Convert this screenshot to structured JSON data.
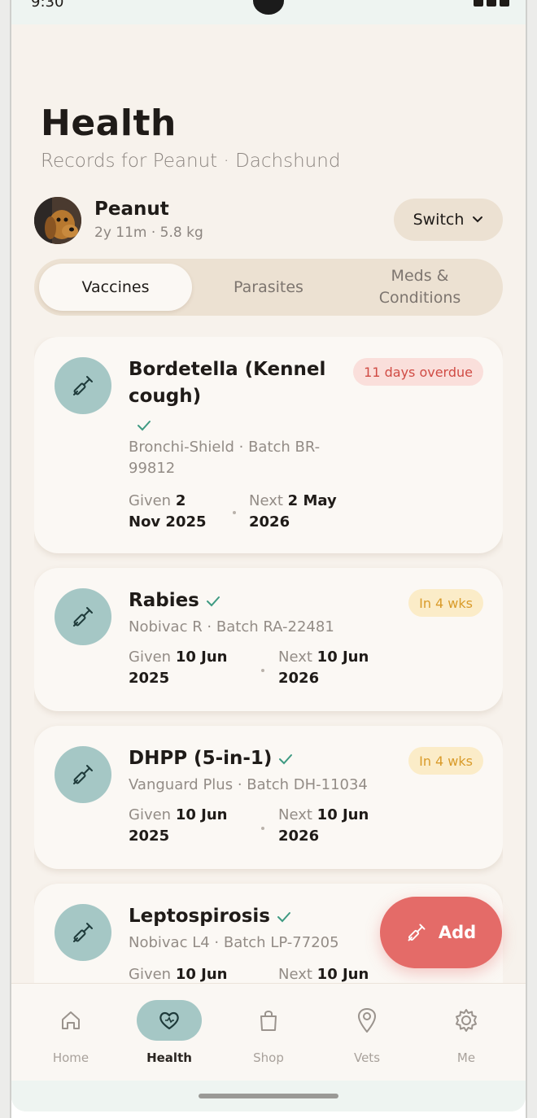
{
  "status": {
    "time": "9:30"
  },
  "header": {
    "title": "Health",
    "subtitle": "Records for Peanut · Dachshund"
  },
  "pet": {
    "name": "Peanut",
    "meta": "2y 11m · 5.8 kg",
    "switch_label": "Switch"
  },
  "tabs": [
    {
      "label": "Vaccines",
      "active": true
    },
    {
      "label": "Parasites",
      "active": false
    },
    {
      "label": "Meds & Conditions",
      "active": false
    }
  ],
  "vaccines": [
    {
      "name": "Bordetella (Kennel cough)",
      "brand_batch": "Bronchi-Shield · Batch BR-99812",
      "badge": "11 days overdue",
      "badge_status": "overdue",
      "given_label": "Given",
      "given_value": "2 Nov 2025",
      "next_label": "Next",
      "next_value": "2 May 2026"
    },
    {
      "name": "Rabies",
      "brand_batch": "Nobivac R · Batch RA-22481",
      "badge": "In 4 wks",
      "badge_status": "soon",
      "given_label": "Given",
      "given_value": "10 Jun 2025",
      "next_label": "Next",
      "next_value": "10 Jun 2026"
    },
    {
      "name": "DHPP (5-in-1)",
      "brand_batch": "Vanguard Plus · Batch DH-11034",
      "badge": "In 4 wks",
      "badge_status": "soon",
      "given_label": "Given",
      "given_value": "10 Jun 2025",
      "next_label": "Next",
      "next_value": "10 Jun 2026"
    },
    {
      "name": "Leptospirosis",
      "brand_batch": "Nobivac L4 · Batch LP-77205",
      "given_label": "Given",
      "given_value": "10 Jun",
      "next_label": "Next",
      "next_value": "10 Jun"
    }
  ],
  "fab": {
    "label": "Add"
  },
  "nav": [
    {
      "label": "Home",
      "icon": "home-icon",
      "active": false
    },
    {
      "label": "Health",
      "icon": "heart-icon",
      "active": true
    },
    {
      "label": "Shop",
      "icon": "shopping-bag-icon",
      "active": false
    },
    {
      "label": "Vets",
      "icon": "map-pin-icon",
      "active": false
    },
    {
      "label": "Me",
      "icon": "gear-icon",
      "active": false
    }
  ],
  "colors": {
    "background": "#f7f2ec",
    "card": "#fbf8f4",
    "accent_teal": "#a5c7c5",
    "fab": "#e46b68",
    "overdue": "#d04b44",
    "soon": "#d99b2a",
    "check": "#3e9a82"
  }
}
